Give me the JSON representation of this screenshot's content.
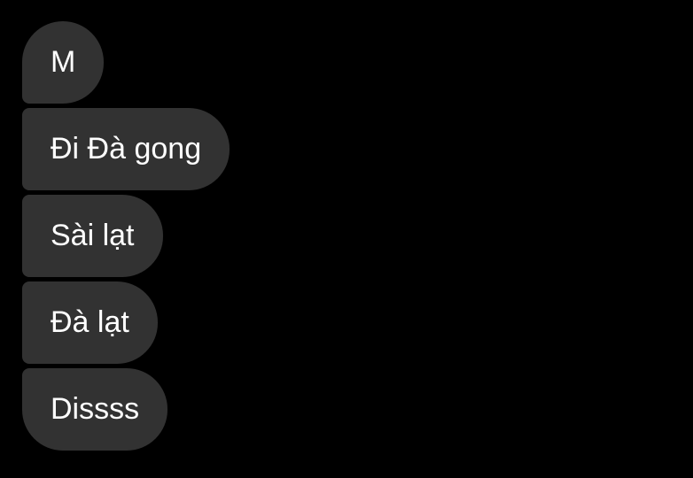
{
  "messages": [
    {
      "text": "M"
    },
    {
      "text": "Đi Đà gong"
    },
    {
      "text": "Sài lạt"
    },
    {
      "text": "Đà lạt"
    },
    {
      "text": "Dissss"
    }
  ],
  "colors": {
    "background": "#000000",
    "bubble": "#323232",
    "text": "#ffffff"
  }
}
